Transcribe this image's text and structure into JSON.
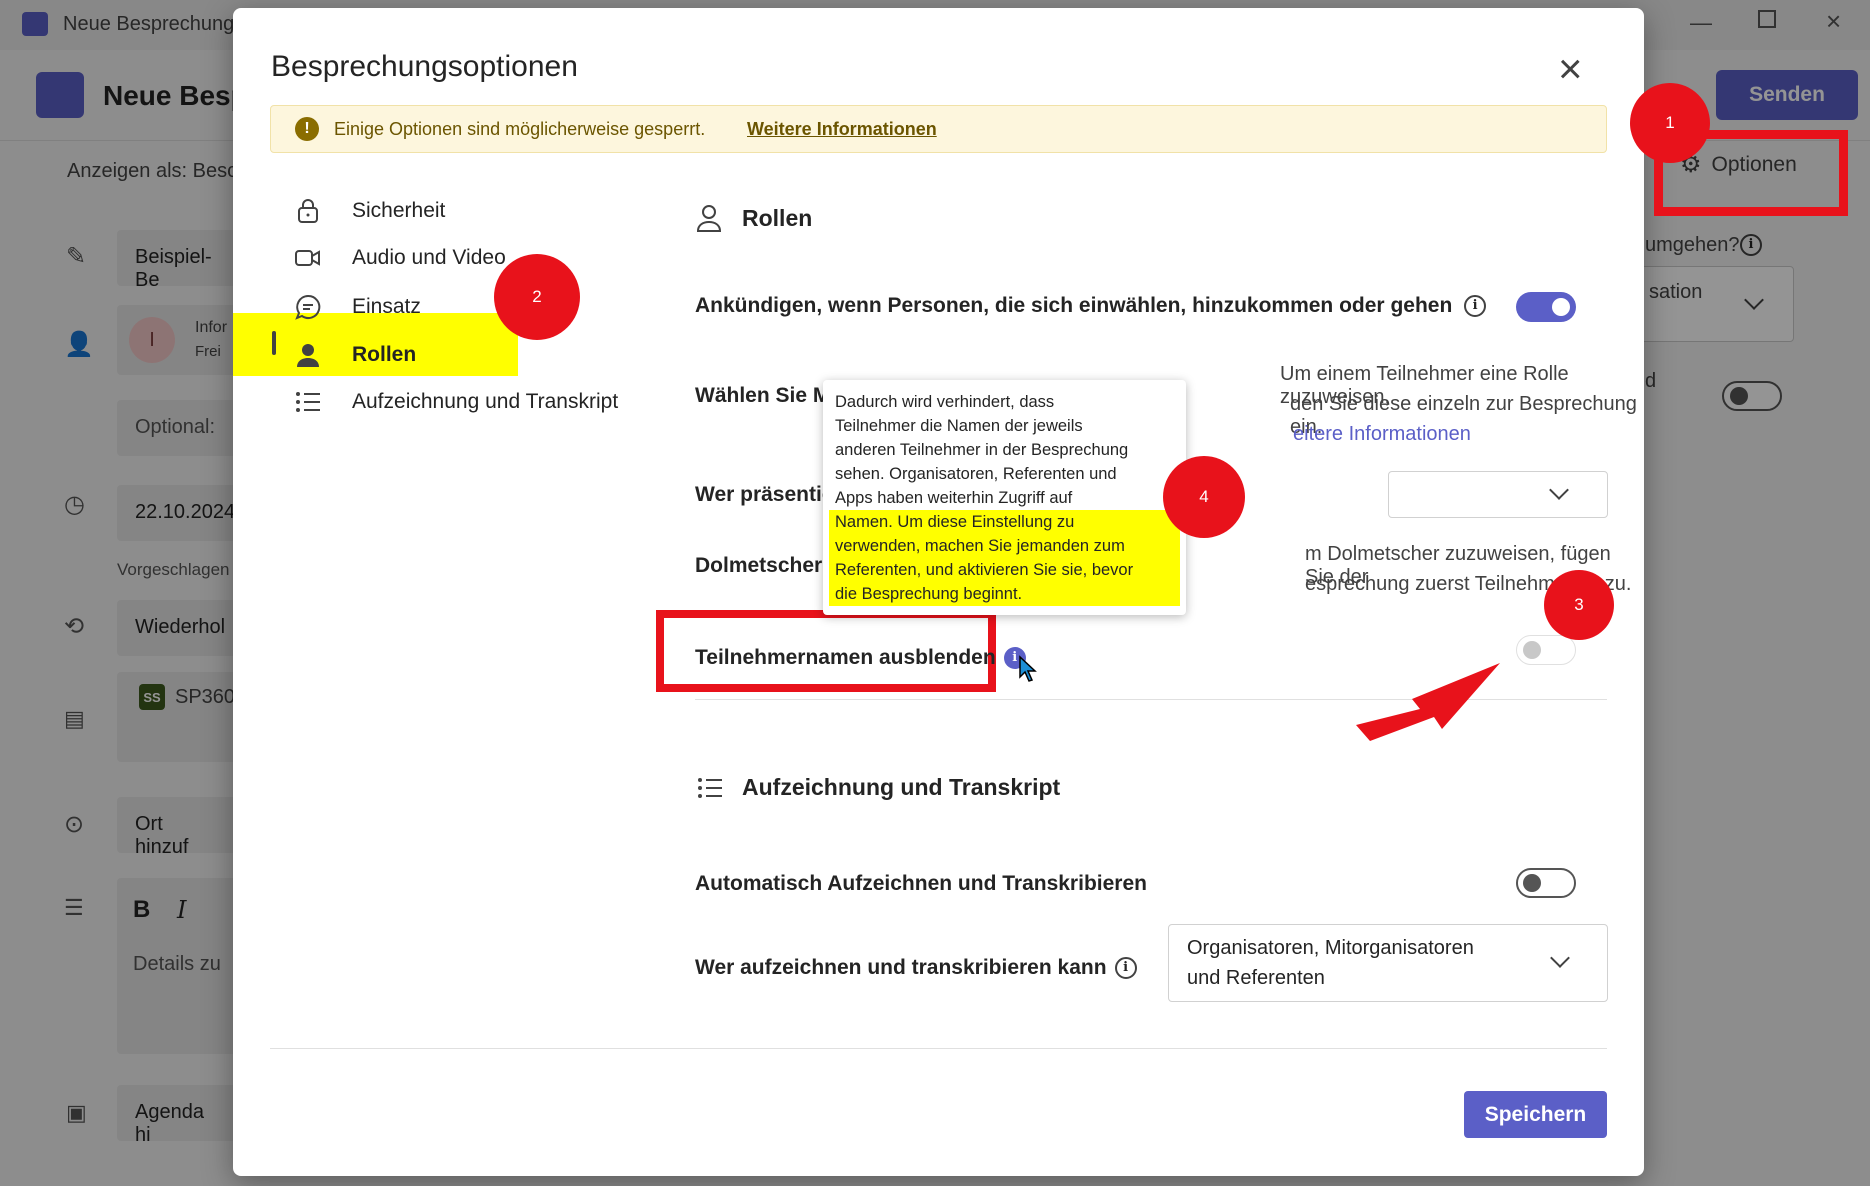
{
  "background_app": {
    "window_title": "Neue Besprechung",
    "header_title": "Neue Besp",
    "send_button": "Senden",
    "show_as": "Anzeigen als: Besc",
    "options_button": "Optionen",
    "title_field": "Beispiel-Be",
    "attendee_initial": "I",
    "attendee_info": "Infor",
    "attendee_status": "Frei",
    "optional_field": "Optional:",
    "date_field": "22.10.2024",
    "suggested": "Vorgeschlagen",
    "repeat_field": "Wiederhol",
    "channel_badge": "SS",
    "channel_name": "SP360",
    "location_field": "Ort hinzuf",
    "details_field": "Details zu",
    "agenda_field": "Agenda hi",
    "right_question": "umgehen?",
    "right_select": "sation",
    "right_d": "d"
  },
  "dialog": {
    "title": "Besprechungsoptionen",
    "close_label": "×",
    "banner": {
      "text": "Einige Optionen sind möglicherweise gesperrt.",
      "link": "Weitere Informationen"
    },
    "nav": [
      {
        "label": "Sicherheit",
        "icon": "lock-icon"
      },
      {
        "label": "Audio und Video",
        "icon": "camera-icon"
      },
      {
        "label": "Einsatz",
        "icon": "chat-icon"
      },
      {
        "label": "Rollen",
        "icon": "person-icon"
      },
      {
        "label": "Aufzeichnung und Transkript",
        "icon": "list-icon"
      }
    ],
    "roles": {
      "heading": "Rollen",
      "announce_label": "Ankündigen, wenn Personen, die sich einwählen, hinzukommen oder gehen",
      "announce_on": true,
      "choose_label": "Wählen Sie M",
      "choose_help": "Um einem Teilnehmer eine Rolle zuzuweisen,",
      "choose_help2": "den Sie diese einzeln zur Besprechung ein.",
      "choose_link": "eitere Informationen",
      "presenter_label": "Wer präsentie",
      "interpreter_label": "Dolmetscher a",
      "interpreter_help": "m Dolmetscher zuzuweisen, fügen Sie der",
      "interpreter_help2": "esprechung zuerst Teilnehmer hinzu.",
      "hide_names_label": "Teilnehmernamen ausblenden",
      "hide_names_on": false
    },
    "tooltip": {
      "plain_lines": [
        "Dadurch wird verhindert, dass",
        "Teilnehmer die Namen der jeweils",
        "anderen Teilnehmer in der Besprechung",
        "sehen. Organisatoren, Referenten und",
        "Apps haben weiterhin Zugriff auf"
      ],
      "highlight_lines": [
        "Namen. Um diese Einstellung zu",
        "verwenden, machen Sie jemanden zum",
        "Referenten, und aktivieren Sie sie, bevor",
        "die Besprechung beginnt."
      ]
    },
    "recording": {
      "heading": "Aufzeichnung und Transkript",
      "auto_label": "Automatisch Aufzeichnen und Transkribieren",
      "auto_on": false,
      "who_label": "Wer aufzeichnen und transkribieren kann",
      "who_value_line1": "Organisatoren, Mitorganisatoren",
      "who_value_line2": "und Referenten"
    },
    "save_button": "Speichern"
  },
  "annotations": {
    "badges": [
      "1",
      "2",
      "3",
      "4"
    ],
    "badge_color": "#e8121b",
    "highlight_color": "#ffff00"
  },
  "colors": {
    "accent": "#5b5fc7",
    "banner_bg": "#fdf6dd",
    "banner_icon": "#8a6d00"
  }
}
